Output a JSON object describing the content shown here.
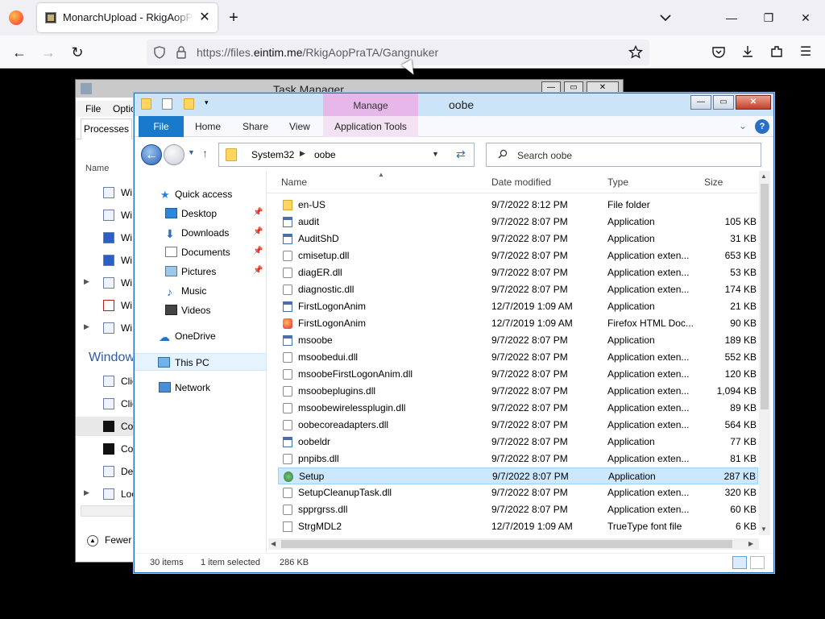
{
  "browser": {
    "tab_title": "MonarchUpload - RkigAopPraTA",
    "url_prefix": "https://files.",
    "url_domain": "eintim.me",
    "url_path": "/RkigAopPraTA/Gangnuker"
  },
  "taskmanager": {
    "title": "Task Manager",
    "menu_file": "File",
    "menu_options": "Optio",
    "tab_processes": "Processes",
    "col_name": "Name",
    "rows": [
      "Wi",
      "Wi",
      "Wi",
      "Wi",
      "Wi",
      "Wi",
      "Wi"
    ],
    "group_windows": "Window",
    "rows2": [
      "Clie",
      "Clie",
      "Co",
      "Co",
      "Des",
      "Loc"
    ],
    "fewer": "Fewer"
  },
  "explorer": {
    "title": "oobe",
    "manage": "Manage",
    "ribbon": {
      "file": "File",
      "home": "Home",
      "share": "Share",
      "view": "View",
      "app_tools": "Application Tools"
    },
    "address": {
      "crumb1": "System32",
      "crumb2": "oobe"
    },
    "search_placeholder": "Search oobe",
    "nav": {
      "quick_access": "Quick access",
      "desktop": "Desktop",
      "downloads": "Downloads",
      "documents": "Documents",
      "pictures": "Pictures",
      "music": "Music",
      "videos": "Videos",
      "onedrive": "OneDrive",
      "thispc": "This PC",
      "network": "Network"
    },
    "columns": {
      "name": "Name",
      "date": "Date modified",
      "type": "Type",
      "size": "Size"
    },
    "files": [
      {
        "name": "en-US",
        "date": "9/7/2022 8:12 PM",
        "type": "File folder",
        "size": "",
        "icon": "folder"
      },
      {
        "name": "audit",
        "date": "9/7/2022 8:07 PM",
        "type": "Application",
        "size": "105 KB",
        "icon": "app"
      },
      {
        "name": "AuditShD",
        "date": "9/7/2022 8:07 PM",
        "type": "Application",
        "size": "31 KB",
        "icon": "app"
      },
      {
        "name": "cmisetup.dll",
        "date": "9/7/2022 8:07 PM",
        "type": "Application exten...",
        "size": "653 KB",
        "icon": "dll"
      },
      {
        "name": "diagER.dll",
        "date": "9/7/2022 8:07 PM",
        "type": "Application exten...",
        "size": "53 KB",
        "icon": "dll"
      },
      {
        "name": "diagnostic.dll",
        "date": "9/7/2022 8:07 PM",
        "type": "Application exten...",
        "size": "174 KB",
        "icon": "dll"
      },
      {
        "name": "FirstLogonAnim",
        "date": "12/7/2019 1:09 AM",
        "type": "Application",
        "size": "21 KB",
        "icon": "app"
      },
      {
        "name": "FirstLogonAnim",
        "date": "12/7/2019 1:09 AM",
        "type": "Firefox HTML Doc...",
        "size": "90 KB",
        "icon": "ff"
      },
      {
        "name": "msoobe",
        "date": "9/7/2022 8:07 PM",
        "type": "Application",
        "size": "189 KB",
        "icon": "app"
      },
      {
        "name": "msoobedui.dll",
        "date": "9/7/2022 8:07 PM",
        "type": "Application exten...",
        "size": "552 KB",
        "icon": "dll"
      },
      {
        "name": "msoobeFirstLogonAnim.dll",
        "date": "9/7/2022 8:07 PM",
        "type": "Application exten...",
        "size": "120 KB",
        "icon": "dll"
      },
      {
        "name": "msoobeplugins.dll",
        "date": "9/7/2022 8:07 PM",
        "type": "Application exten...",
        "size": "1,094 KB",
        "icon": "dll"
      },
      {
        "name": "msoobewirelessplugin.dll",
        "date": "9/7/2022 8:07 PM",
        "type": "Application exten...",
        "size": "89 KB",
        "icon": "dll"
      },
      {
        "name": "oobecoreadapters.dll",
        "date": "9/7/2022 8:07 PM",
        "type": "Application exten...",
        "size": "564 KB",
        "icon": "dll"
      },
      {
        "name": "oobeldr",
        "date": "9/7/2022 8:07 PM",
        "type": "Application",
        "size": "77 KB",
        "icon": "app"
      },
      {
        "name": "pnpibs.dll",
        "date": "9/7/2022 8:07 PM",
        "type": "Application exten...",
        "size": "81 KB",
        "icon": "dll"
      },
      {
        "name": "Setup",
        "date": "9/7/2022 8:07 PM",
        "type": "Application",
        "size": "287 KB",
        "icon": "setup",
        "selected": true
      },
      {
        "name": "SetupCleanupTask.dll",
        "date": "9/7/2022 8:07 PM",
        "type": "Application exten...",
        "size": "320 KB",
        "icon": "dll"
      },
      {
        "name": "spprgrss.dll",
        "date": "9/7/2022 8:07 PM",
        "type": "Application exten...",
        "size": "60 KB",
        "icon": "dll"
      },
      {
        "name": "StrgMDL2",
        "date": "12/7/2019 1:09 AM",
        "type": "TrueType font file",
        "size": "6 KB",
        "icon": "font"
      }
    ],
    "status": {
      "count": "30 items",
      "selected": "1 item selected",
      "size": "286 KB"
    }
  }
}
